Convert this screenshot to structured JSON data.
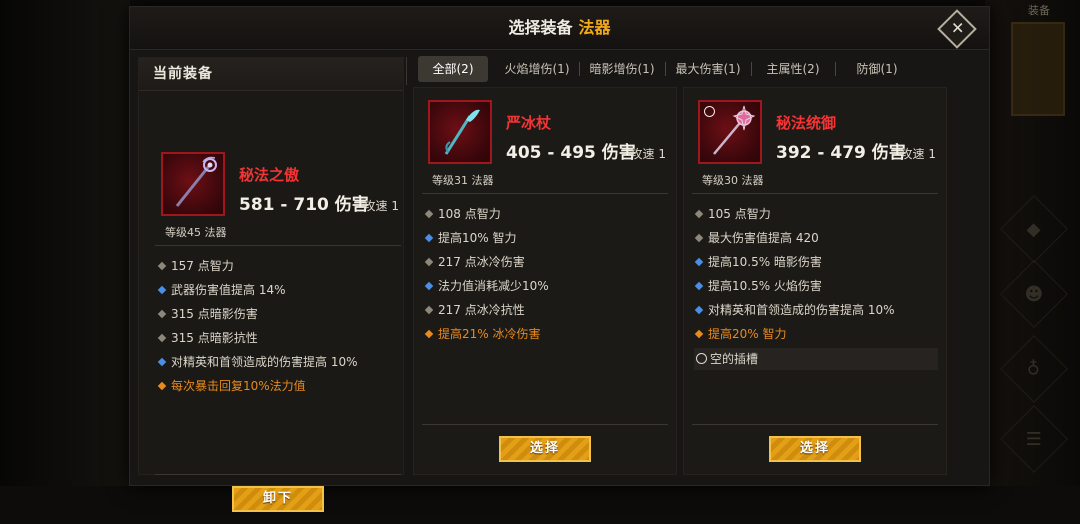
{
  "side": {
    "top_label": "装备"
  },
  "dialog": {
    "title": "选择装备",
    "category": "法器",
    "close_symbol": "✕",
    "current_label": "当前装备"
  },
  "tabs": [
    {
      "label": "全部(2)",
      "active": true
    },
    {
      "label": "火焰增伤(1)"
    },
    {
      "label": "暗影增伤(1)"
    },
    {
      "label": "最大伤害(1)"
    },
    {
      "label": "主属性(2)"
    },
    {
      "label": "防御(1)"
    }
  ],
  "current": {
    "name": "秘法之傲",
    "damage": "581 - 710 伤害",
    "speed": "攻速 1",
    "level": "等级45 法器",
    "icon": "arcane-staff-icon",
    "stats": [
      {
        "text": "157 点智力",
        "type": "base"
      },
      {
        "text": "武器伤害值提高 14%",
        "type": "blue"
      },
      {
        "text": "315 点暗影伤害",
        "type": "base"
      },
      {
        "text": "315 点暗影抗性",
        "type": "base"
      },
      {
        "text": "对精英和首领造成的伤害提高 10%",
        "type": "blue"
      },
      {
        "text": "每次暴击回复10%法力值",
        "type": "orange"
      }
    ],
    "button": "卸下"
  },
  "items": [
    {
      "name": "严冰杖",
      "damage": "405 - 495 伤害",
      "speed": "攻速 1",
      "level": "等级31 法器",
      "icon": "ice-staff-icon",
      "stats": [
        {
          "text": "108 点智力",
          "type": "base"
        },
        {
          "text": "提高10% 智力",
          "type": "blue"
        },
        {
          "text": "217 点冰冷伤害",
          "type": "base"
        },
        {
          "text": "法力值消耗减少10%",
          "type": "blue"
        },
        {
          "text": "217 点冰冷抗性",
          "type": "base"
        },
        {
          "text": "提高21% 冰冷伤害",
          "type": "orange"
        }
      ],
      "button": "选择"
    },
    {
      "name": "秘法统御",
      "damage": "392 - 479 伤害",
      "speed": "攻速 1",
      "level": "等级30 法器",
      "icon": "arcane-scepter-icon",
      "stats": [
        {
          "text": "105 点智力",
          "type": "base"
        },
        {
          "text": "最大伤害值提高 420",
          "type": "base"
        },
        {
          "text": "提高10.5% 暗影伤害",
          "type": "blue"
        },
        {
          "text": "提高10.5% 火焰伤害",
          "type": "blue"
        },
        {
          "text": "对精英和首领造成的伤害提高 10%",
          "type": "blue"
        },
        {
          "text": "提高20% 智力",
          "type": "orange"
        }
      ],
      "empty_slot": "空的插槽",
      "button": "选择"
    }
  ],
  "colors": {
    "accent": "#f2a91b",
    "legendary_name": "#f43434",
    "blue_affix": "#4a8ee8",
    "orange_affix": "#e88a1e"
  }
}
